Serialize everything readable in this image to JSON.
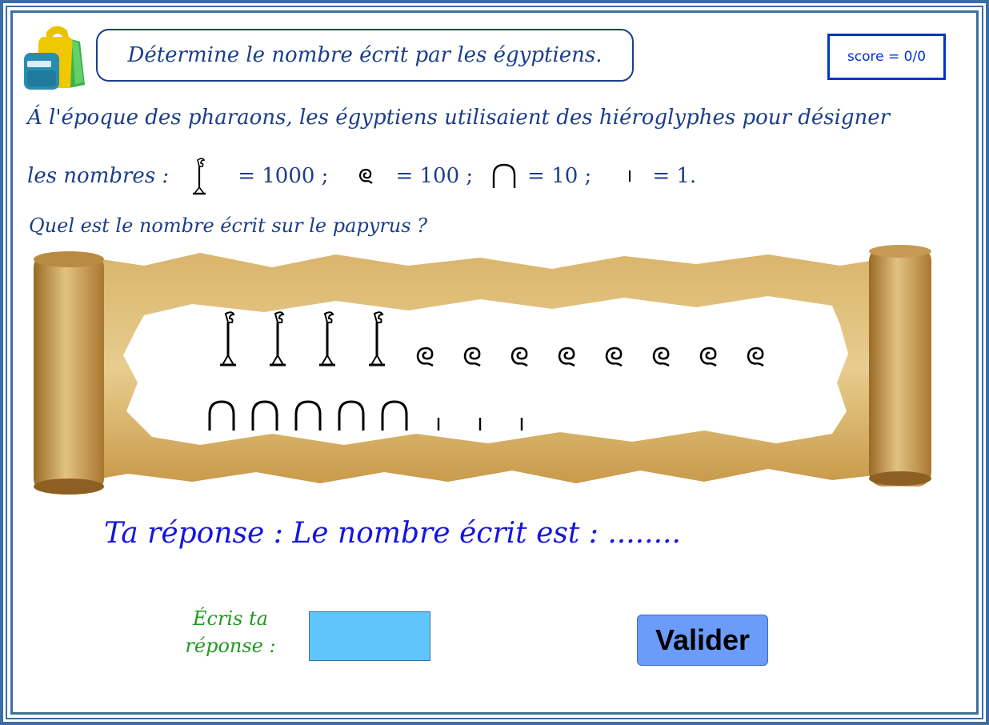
{
  "instruction": "Détermine le nombre écrit par les égyptiens.",
  "score": "score = 0/0",
  "intro": {
    "line1": "Á l'époque des pharaons, les égyptiens utilisaient des hiéroglyphes pour désigner",
    "line2_prefix": "les nombres :",
    "eq_1000": "= 1000 ;",
    "eq_100": "= 100 ;",
    "eq_10": "= 10 ;",
    "eq_1": "= 1.",
    "question": "Quel est le nombre écrit sur le papyrus ?"
  },
  "papyrus": {
    "thousands": 4,
    "hundreds": 8,
    "tens": 5,
    "units": 3
  },
  "answer_line": "Ta réponse : Le nombre écrit est : ........",
  "input_label": "Écris ta réponse :",
  "input_value": "",
  "validate_label": "Valider",
  "colors": {
    "frame": "#3a6ea5",
    "text_blue": "#1b3e8a",
    "answer_blue": "#1515e0",
    "label_green": "#1f9a1f",
    "input_bg": "#5ec6fb",
    "button_bg": "#6c9cf9"
  },
  "icons": {
    "bag": "backpack-icon",
    "thousand": "lotus-flower-hieroglyph",
    "hundred": "coiled-rope-hieroglyph",
    "ten": "heel-bone-hieroglyph",
    "one": "stroke-hieroglyph"
  }
}
